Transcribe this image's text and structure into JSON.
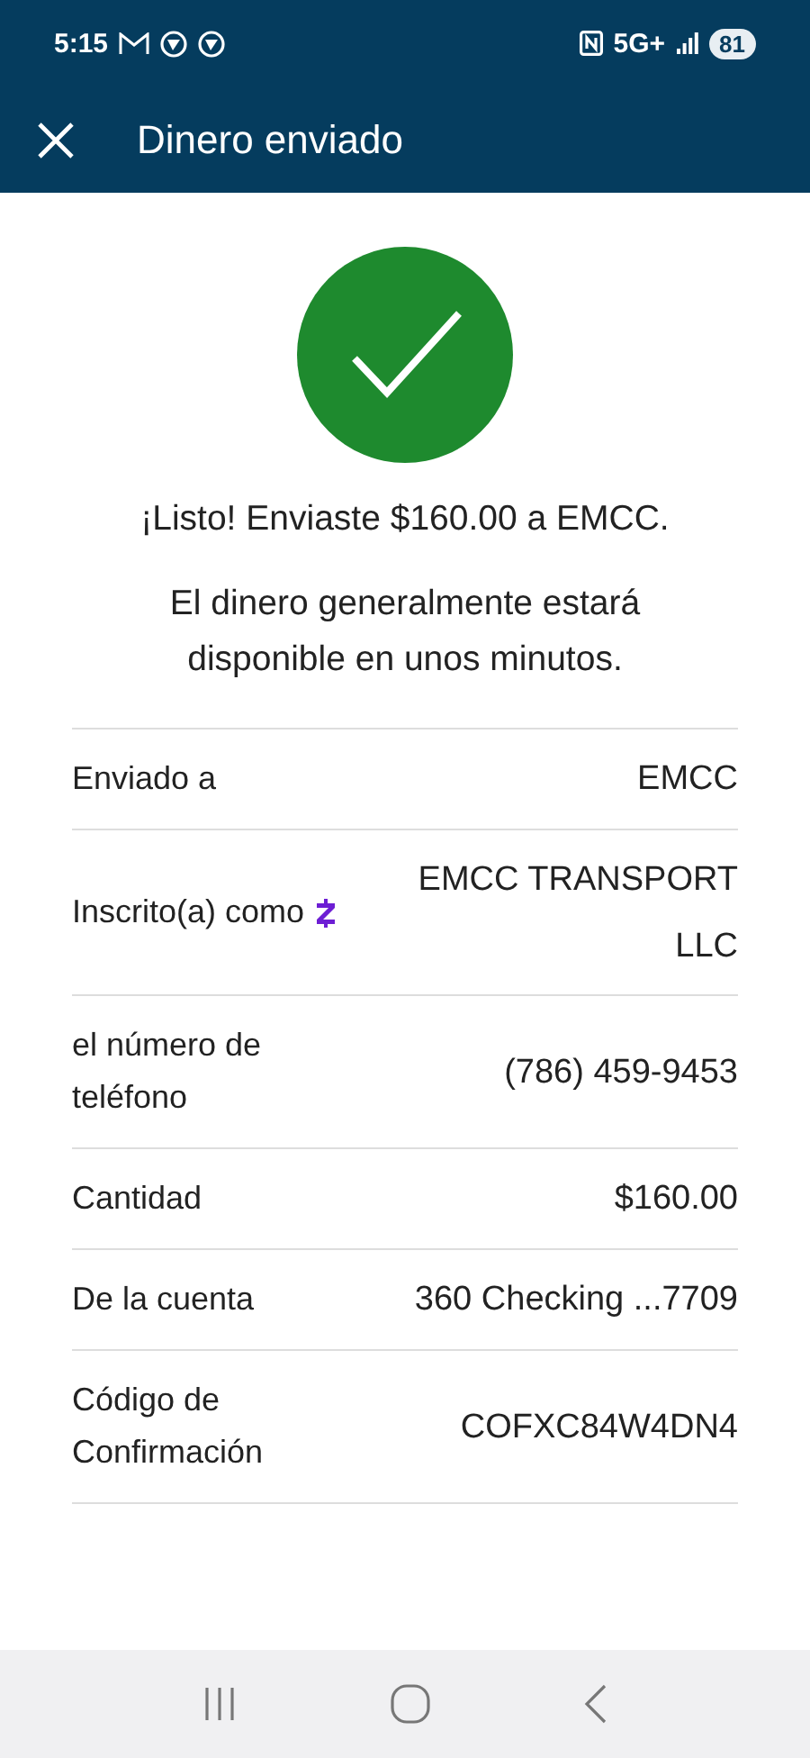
{
  "status_bar": {
    "time": "5:15",
    "network": "5G+",
    "battery": "81"
  },
  "header": {
    "title": "Dinero enviado"
  },
  "headline": "¡Listo! Enviaste $160.00 a EMCC.",
  "message": "El dinero generalmente estará disponible en unos minutos.",
  "details": [
    {
      "kind": "plain",
      "label": "Enviado a",
      "value": "EMCC"
    },
    {
      "kind": "zelle",
      "label": "Inscrito(a) como",
      "value": "EMCC TRANSPORT LLC"
    },
    {
      "kind": "plain",
      "label": "el número de teléfono",
      "value": "(786) 459-9453"
    },
    {
      "kind": "plain",
      "label": "Cantidad",
      "value": "$160.00"
    },
    {
      "kind": "plain",
      "label": "De la cuenta",
      "value": "360 Checking ...7709"
    },
    {
      "kind": "plain",
      "label": "Código de Confirmación",
      "value": "COFXC84W4DN4"
    }
  ]
}
